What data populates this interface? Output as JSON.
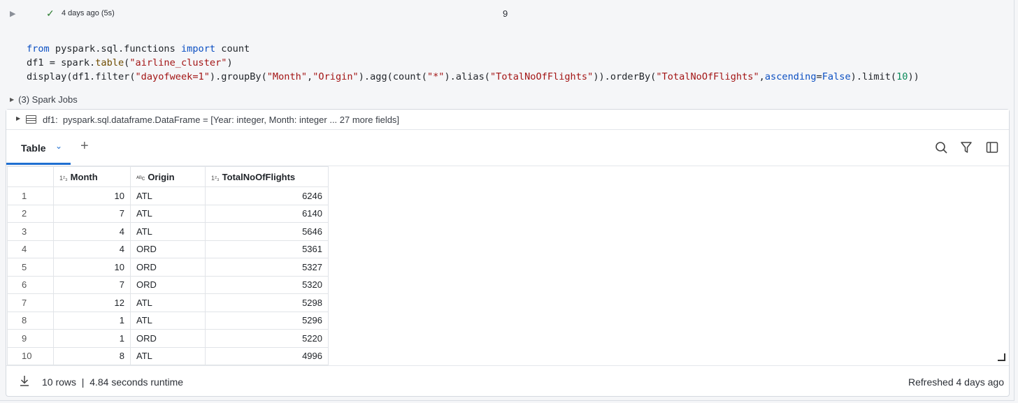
{
  "cell": {
    "status": "4 days ago (5s)",
    "number": "9"
  },
  "code": {
    "line1": {
      "kw1": "from",
      "mod": " pyspark.sql.functions ",
      "kw2": "import",
      "rest": " count"
    },
    "line2": {
      "a": "df1 = spark.",
      "fn": "table",
      "b": "(",
      "s": "\"airline_cluster\"",
      "c": ")"
    },
    "line3": {
      "a": "display(df1.filter(",
      "s1": "\"dayofweek=1\"",
      "b": ").groupBy(",
      "s2": "\"Month\"",
      "c": ",",
      "s3": "\"Origin\"",
      "d": ").agg(count(",
      "s4": "\"*\"",
      "e": ").alias(",
      "s5": "\"TotalNoOfFlights\"",
      "f": ")).orderBy(",
      "s6": "\"TotalNoOfFlights\"",
      "g": ",",
      "arg": "ascending",
      "h": "=",
      "kw": "False",
      "i": ").limit(",
      "n": "10",
      "j": "))"
    }
  },
  "jobs": "(3) Spark Jobs",
  "dataframe": {
    "name": "df1:",
    "schema": "pyspark.sql.dataframe.DataFrame = [Year: integer, Month: integer ... 27 more fields]"
  },
  "tabs": {
    "active": "Table",
    "add": "+"
  },
  "table": {
    "columns": [
      {
        "type": "123",
        "name": "Month"
      },
      {
        "type": "ABC",
        "name": "Origin"
      },
      {
        "type": "123",
        "name": "TotalNoOfFlights"
      }
    ],
    "rows": [
      {
        "idx": "1",
        "month": "10",
        "origin": "ATL",
        "total": "6246"
      },
      {
        "idx": "2",
        "month": "7",
        "origin": "ATL",
        "total": "6140"
      },
      {
        "idx": "3",
        "month": "4",
        "origin": "ATL",
        "total": "5646"
      },
      {
        "idx": "4",
        "month": "4",
        "origin": "ORD",
        "total": "5361"
      },
      {
        "idx": "5",
        "month": "10",
        "origin": "ORD",
        "total": "5327"
      },
      {
        "idx": "6",
        "month": "7",
        "origin": "ORD",
        "total": "5320"
      },
      {
        "idx": "7",
        "month": "12",
        "origin": "ATL",
        "total": "5298"
      },
      {
        "idx": "8",
        "month": "1",
        "origin": "ATL",
        "total": "5296"
      },
      {
        "idx": "9",
        "month": "1",
        "origin": "ORD",
        "total": "5220"
      },
      {
        "idx": "10",
        "month": "8",
        "origin": "ATL",
        "total": "4996"
      }
    ]
  },
  "footer": {
    "summary": "10 rows  |  4.84 seconds runtime",
    "refreshed": "Refreshed 4 days ago"
  },
  "colors": {
    "accent": "#1f6fd1",
    "success": "#2e7d32",
    "string": "#a31515",
    "keyword": "#0b4fc2"
  },
  "icons": [
    "run-icon",
    "check-icon",
    "table-schema-icon",
    "chevron-down-icon",
    "search-icon",
    "filter-icon",
    "sidebar-panel-icon",
    "download-icon",
    "resize-handle-icon"
  ]
}
